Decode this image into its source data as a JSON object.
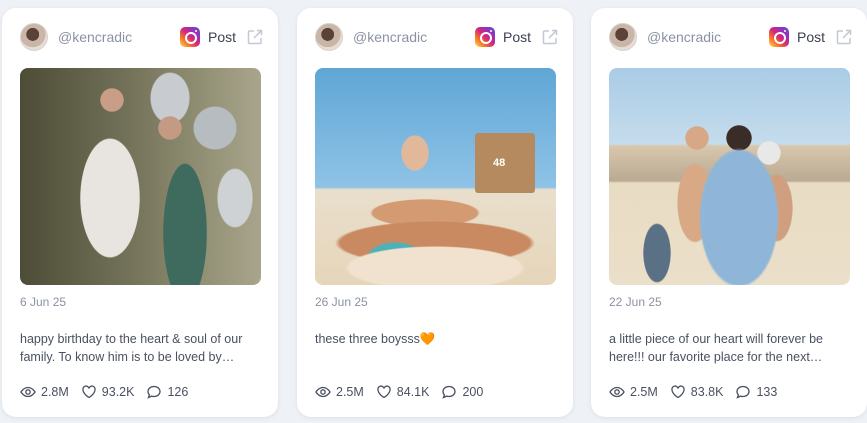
{
  "cards": [
    {
      "handle": "@kencradic",
      "platform_label": "Post",
      "date": "6 Jun 25",
      "caption": "happy birthday to the heart & soul of our family. To know him is to be loved by…",
      "views": "2.8M",
      "likes": "93.2K",
      "comments": "126"
    },
    {
      "handle": "@kencradic",
      "platform_label": "Post",
      "date": "26 Jun 25",
      "caption": "these three boysss🧡",
      "views": "2.5M",
      "likes": "84.1K",
      "comments": "200"
    },
    {
      "handle": "@kencradic",
      "platform_label": "Post",
      "date": "22 Jun 25",
      "caption": "a little piece of our heart will forever be here!!! our favorite place for the next…",
      "views": "2.5M",
      "likes": "83.8K",
      "comments": "133"
    }
  ],
  "icons": {
    "platform": "instagram-icon",
    "external": "external-link-icon",
    "views": "eye-icon",
    "likes": "heart-icon",
    "comments": "comment-icon"
  },
  "colors": {
    "page_bg": "#eef1f6",
    "card_bg": "#ffffff",
    "muted_text": "#8a92a3"
  }
}
